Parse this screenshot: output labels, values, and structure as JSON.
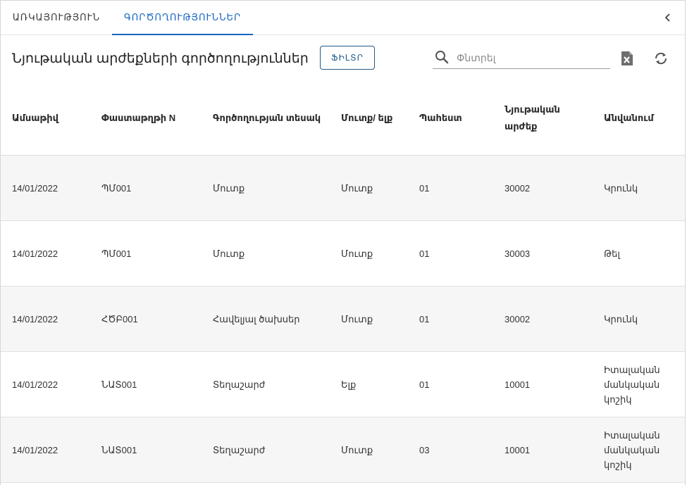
{
  "tabs": [
    {
      "label": "ԱՌԿԱՅՈՒԹՅՈՒՆ",
      "active": false
    },
    {
      "label": "ԳՈՐԾՈՂՈՒԹՅՈՒՆՆԵՐ",
      "active": true
    }
  ],
  "toolbar": {
    "title": "Նյութական արժեքների գործողություններ",
    "filter_label": "ՖԻԼՏՐ",
    "search_placeholder": "Փնտրել"
  },
  "icons": {
    "collapse": "chevron-left-icon",
    "search": "search-icon",
    "excel": "excel-export-icon",
    "refresh": "refresh-icon"
  },
  "colors": {
    "accent": "#1565c0",
    "filter_border": "#1e5a8a",
    "row_alt": "#f6f6f6"
  },
  "table": {
    "headers": [
      "Ամսաթիվ",
      "Փաստաթղթի N",
      "Գործողության տեսակ",
      "Մուտք/ ելք",
      "Պահեստ",
      "Նյութական արժեք",
      "Անվանում"
    ],
    "rows": [
      [
        "14/01/2022",
        "ՊՄ001",
        "Մուտք",
        "Մուտք",
        "01",
        "30002",
        "Կրունկ"
      ],
      [
        "14/01/2022",
        "ՊՄ001",
        "Մուտք",
        "Մուտք",
        "01",
        "30003",
        "Թել"
      ],
      [
        "14/01/2022",
        "ՀԾԲ001",
        "Հավելյալ ծախսեր",
        "Մուտք",
        "01",
        "30002",
        "Կրունկ"
      ],
      [
        "14/01/2022",
        "ՆԱՏ001",
        "Տեղաշարժ",
        "Ելք",
        "01",
        "10001",
        "Իտալական մանկական կոշիկ"
      ],
      [
        "14/01/2022",
        "ՆԱՏ001",
        "Տեղաշարժ",
        "Մուտք",
        "03",
        "10001",
        "Իտալական մանկական կոշիկ"
      ]
    ]
  }
}
